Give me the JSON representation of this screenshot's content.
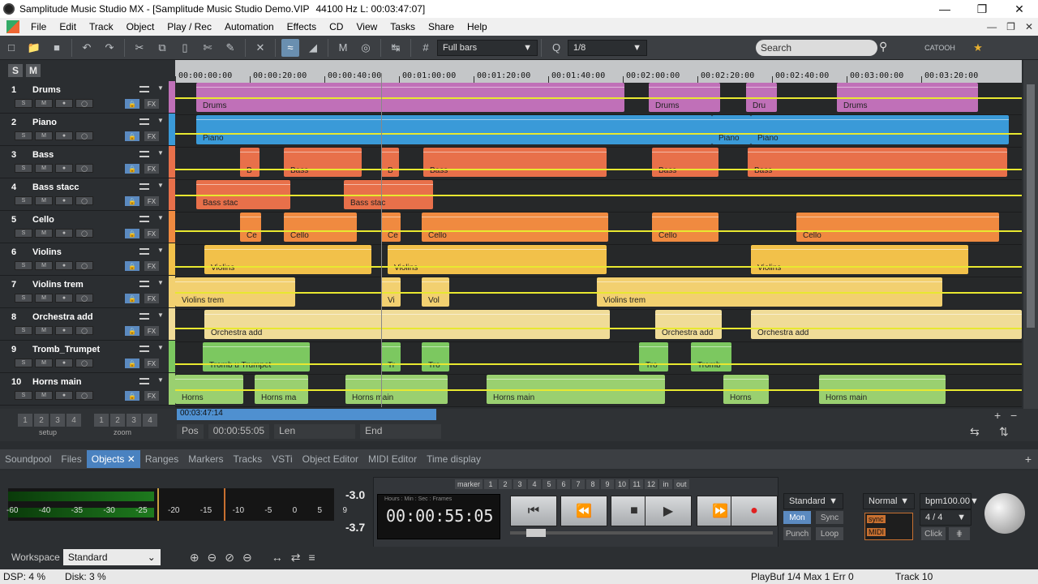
{
  "window": {
    "title": "Samplitude Music Studio MX - [Samplitude Music Studio Demo.VIP",
    "audio_info": "44100 Hz L: 00:03:47:07]"
  },
  "menu": [
    "File",
    "Edit",
    "Track",
    "Object",
    "Play / Rec",
    "Automation",
    "Effects",
    "CD",
    "View",
    "Tasks",
    "Share",
    "Help"
  ],
  "toolbar": {
    "grid_mode": "Full bars",
    "quantize": "1/8",
    "search_placeholder": "Search"
  },
  "tracks": [
    {
      "num": "1",
      "name": "Drums",
      "color": "#c070b8"
    },
    {
      "num": "2",
      "name": "Piano",
      "color": "#3a9ad8"
    },
    {
      "num": "3",
      "name": "Bass",
      "color": "#e8704a"
    },
    {
      "num": "4",
      "name": "Bass stacc",
      "color": "#e8704a"
    },
    {
      "num": "5",
      "name": "Cello",
      "color": "#f08a40"
    },
    {
      "num": "6",
      "name": "Violins",
      "color": "#f2c14a"
    },
    {
      "num": "7",
      "name": "Violins trem",
      "color": "#f2d070"
    },
    {
      "num": "8",
      "name": "Orchestra add",
      "color": "#f0dc98"
    },
    {
      "num": "9",
      "name": "Tromb_Trumpet",
      "color": "#7cc860"
    },
    {
      "num": "10",
      "name": "Horns main",
      "color": "#9ad070"
    }
  ],
  "ruler_ticks": [
    "00:00:00:00",
    "00:00:20:00",
    "00:00:40:00",
    "00:01:00:00",
    "00:01:20:00",
    "00:01:40:00",
    "00:02:00:00",
    "00:02:20:00",
    "00:02:40:00",
    "00:03:00:00",
    "00:03:20:00"
  ],
  "clip_labels": {
    "drums": [
      "Drums",
      "Drums",
      "Dru",
      "Drums"
    ],
    "piano": [
      "Piano",
      "Piano",
      "Piano"
    ],
    "bass": [
      "B",
      "Bass",
      "B",
      "Bass",
      "Bass",
      "Bass"
    ],
    "bass_stacc": [
      "Bass stac",
      "Bass stac"
    ],
    "cello": [
      "Ce",
      "Cello",
      "Ce",
      "Cello",
      "Cello",
      "Cello"
    ],
    "violins": [
      "Violins",
      "Violins",
      "Violins"
    ],
    "violins_trem": [
      "Violins trem",
      "Vi",
      "Vol",
      "Violins trem"
    ],
    "orchestra": [
      "Orchestra add",
      "Orchestra add",
      "Orchestra add"
    ],
    "tromb": [
      "Tromb u Trumpet",
      "Tr",
      "Tro",
      "Tro",
      "Tromb"
    ],
    "horns": [
      "Horns",
      "Horns ma",
      "Horns main",
      "Horns main",
      "Horns",
      "Horns main"
    ]
  },
  "position": {
    "bar_time": "00:03:47:14",
    "pos_label": "Pos",
    "pos_value": "00:00:55:05",
    "len_label": "Len",
    "end_label": "End",
    "setup_label": "setup",
    "zoom_label": "zoom",
    "page_nums": [
      "1",
      "2",
      "3",
      "4"
    ]
  },
  "tabs": [
    "Soundpool",
    "Files",
    "Objects",
    "Ranges",
    "Markers",
    "Tracks",
    "VSTi",
    "Object Editor",
    "MIDI Editor",
    "Time display"
  ],
  "active_tab": "Objects",
  "meter": {
    "scale": [
      "-60",
      "-40",
      "-35",
      "-30",
      "-25",
      "-20",
      "-15",
      "-10",
      "-5",
      "0",
      "5",
      "9"
    ],
    "peak_top": "-3.0",
    "peak_bottom": "-3.7"
  },
  "transport": {
    "clock_format": "Hours : Min : Sec : Frames",
    "clock_time": "00:00:55:05",
    "marker_label": "marker",
    "markers": [
      "1",
      "2",
      "3",
      "4",
      "5",
      "6",
      "7",
      "8",
      "9",
      "10",
      "11",
      "12"
    ],
    "in_label": "in",
    "out_label": "out",
    "mode": "Standard",
    "mon": "Mon",
    "sync": "Sync",
    "punch": "Punch",
    "loop": "Loop",
    "normal": "Normal",
    "bpm": "bpm100.00",
    "sig": "4 / 4",
    "click": "Click"
  },
  "workspace": {
    "label": "Workspace",
    "value": "Standard"
  },
  "status": {
    "dsp": "DSP: 4 %",
    "disk": "Disk:  3 %",
    "playbuf": "PlayBuf 1/4  Max 1  Err 0",
    "track": "Track 10"
  }
}
